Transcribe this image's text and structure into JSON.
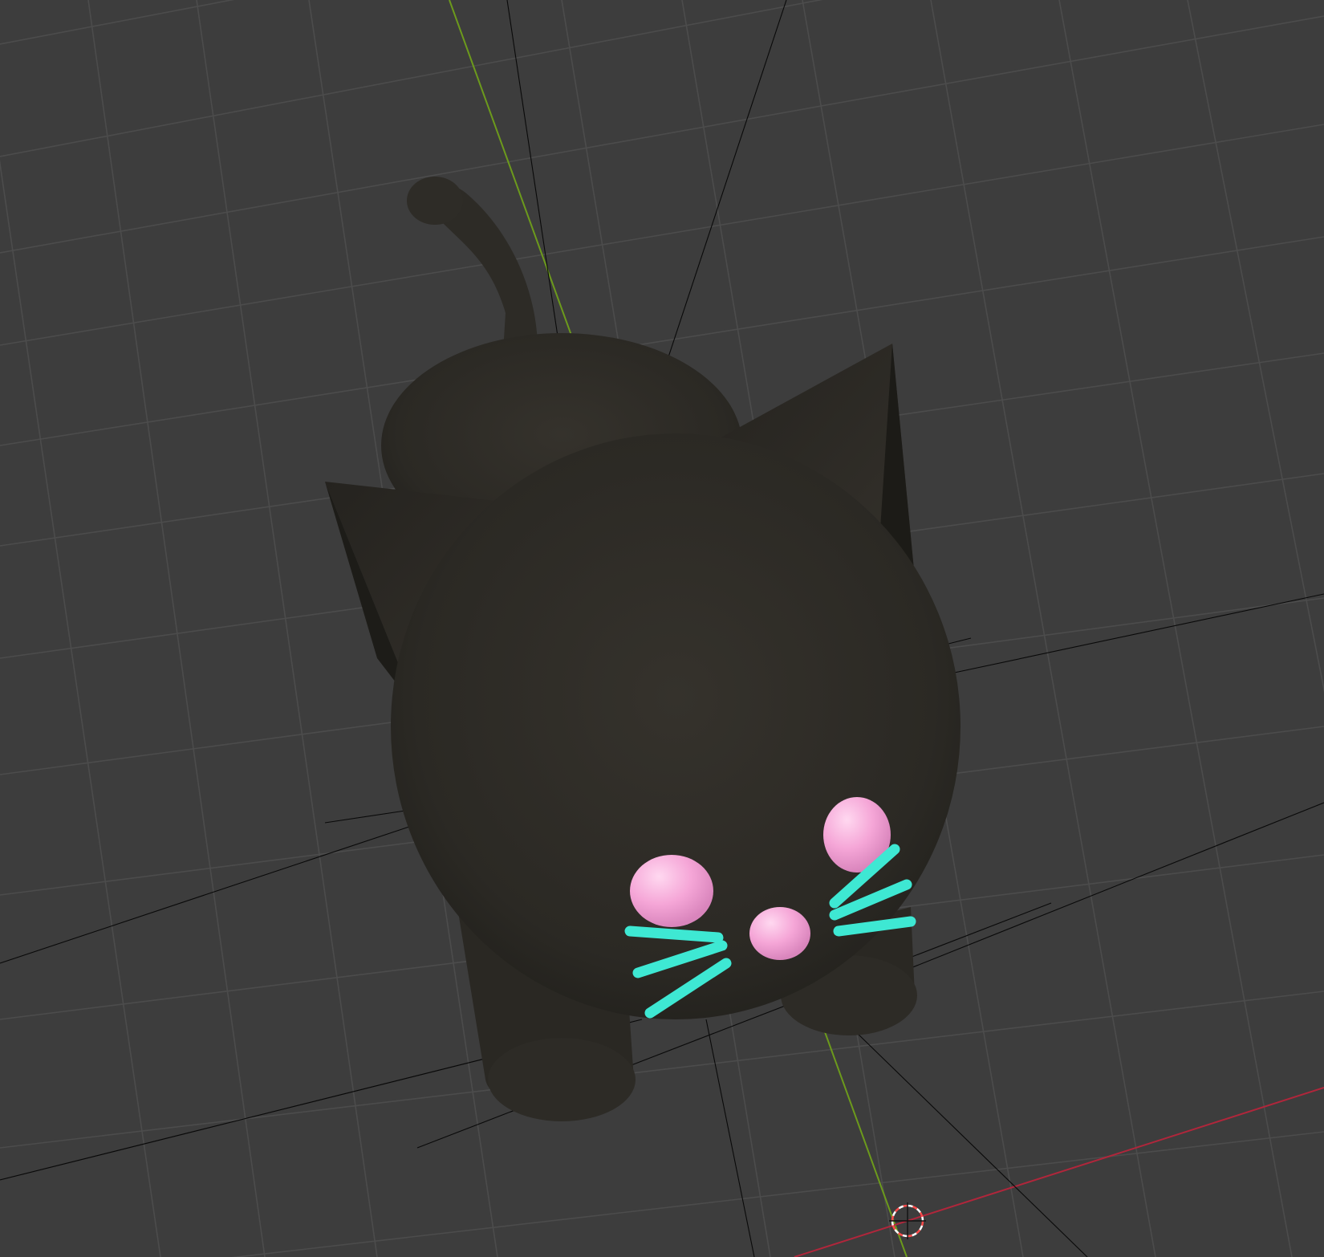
{
  "viewport": {
    "background_color": "#3d3d3d",
    "grid_line_color": "#4a4a4a",
    "x_axis_color": "#b0263b",
    "y_axis_color": "#6c9a1c",
    "helper_line_color": "#000000",
    "cursor_color_a": "#ff4b4b",
    "cursor_color_b": "#ffffff"
  },
  "model": {
    "body_color": "#2d2b26",
    "shadow_color": "#201f1b",
    "eye_color": "#f4a6d6",
    "eye_highlight_color": "#ffd6f1",
    "nose_color": "#f7a6d8",
    "whisker_color": "#3ee8d3",
    "ear_color": "#2a2823",
    "ear_edge_color": "#1b1a17"
  }
}
